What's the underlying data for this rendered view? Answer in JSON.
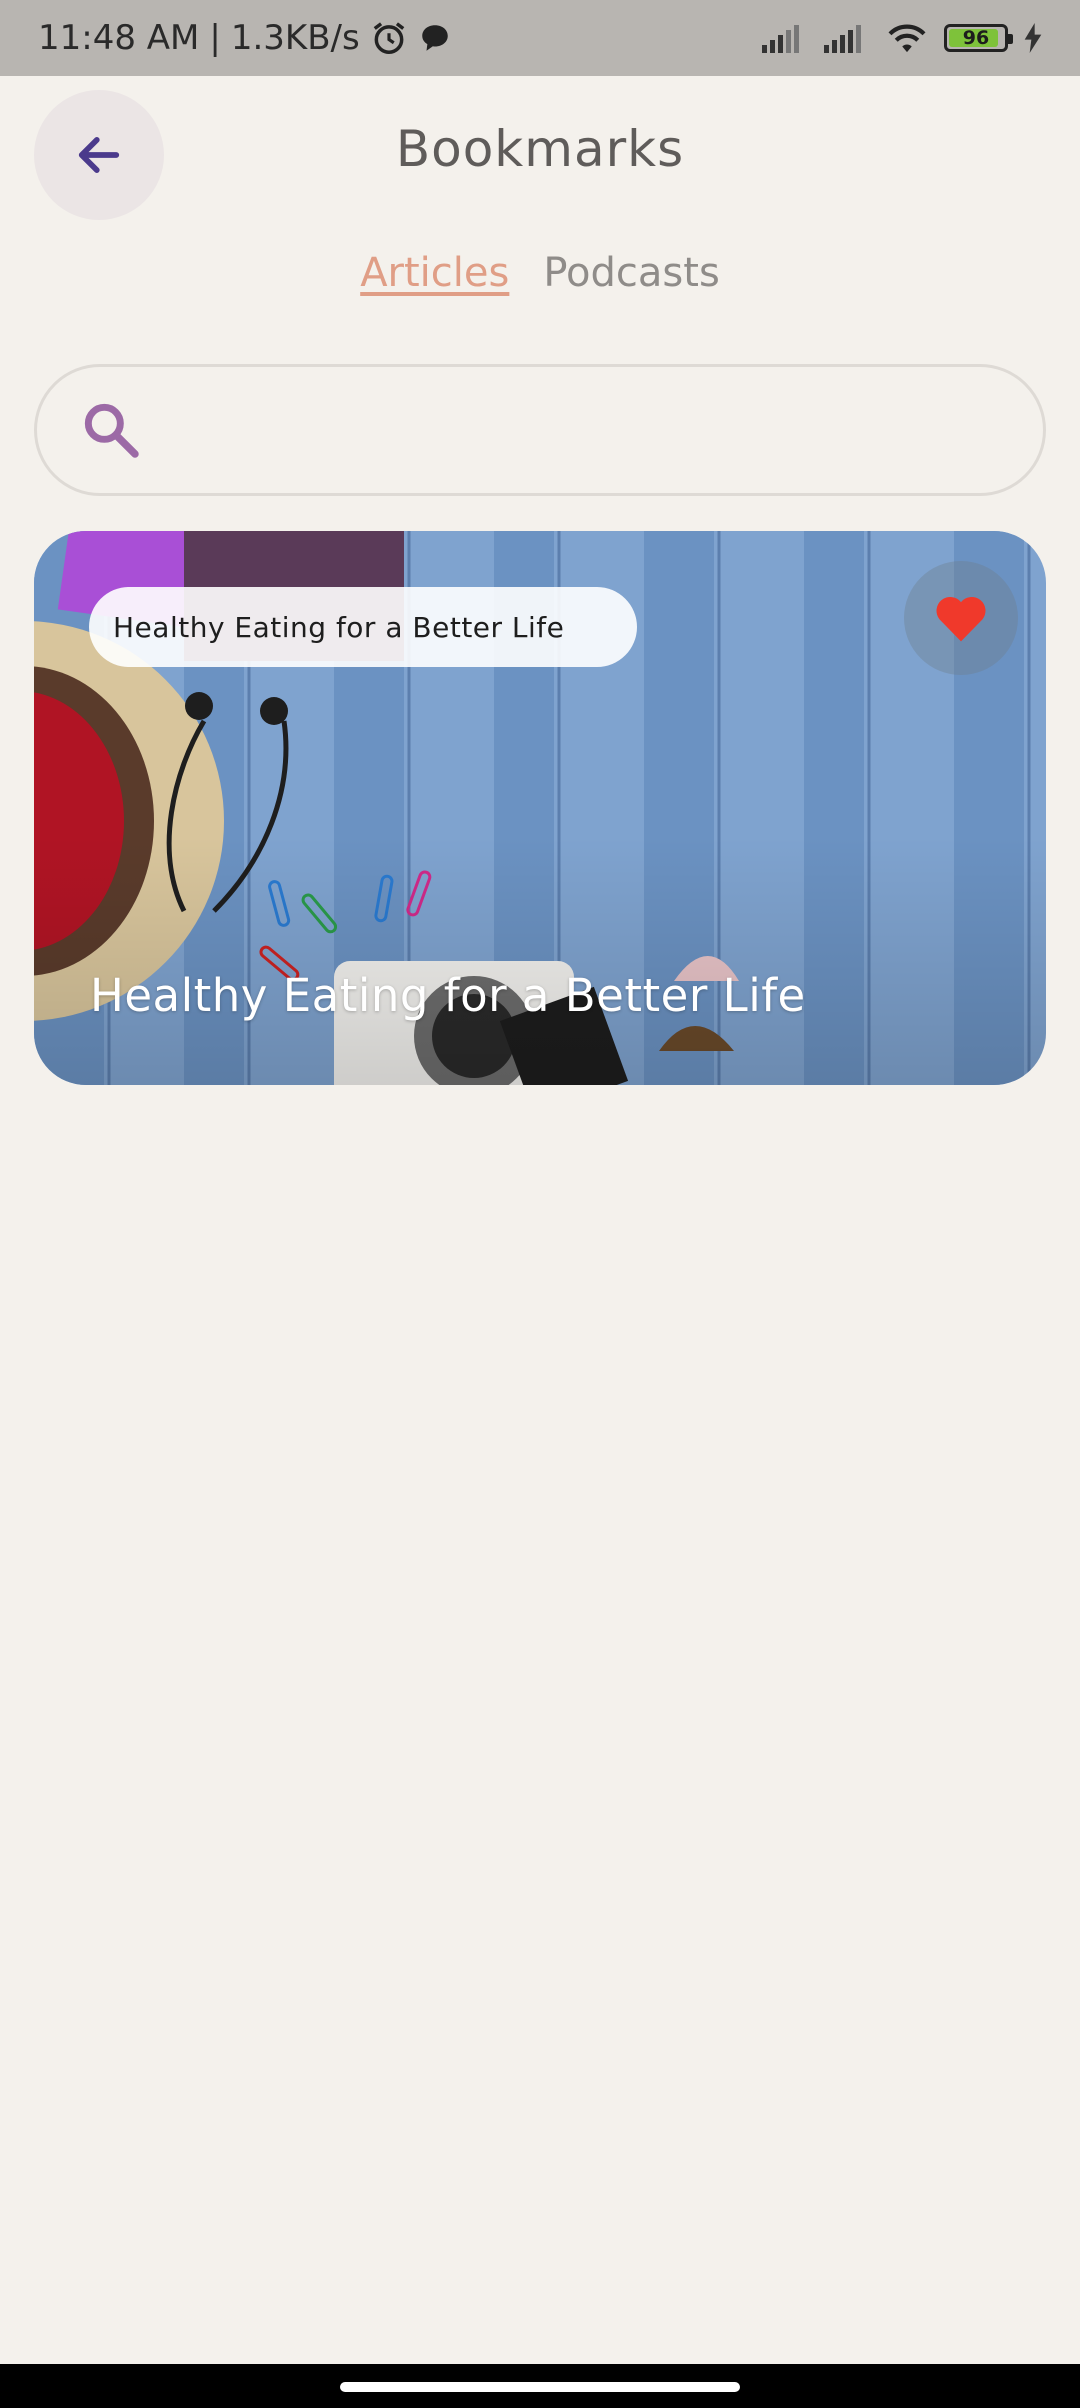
{
  "status_bar": {
    "time": "11:48 AM",
    "separator": "|",
    "speed": "1.3KB/s",
    "battery": "96",
    "icons": [
      "alarm-icon",
      "chat-icon",
      "signal-icon",
      "signal-icon",
      "wifi-icon",
      "battery-icon",
      "charging-icon"
    ]
  },
  "header": {
    "title": "Bookmarks",
    "back_icon": "arrow-left-icon"
  },
  "tabs": [
    {
      "label": "Articles",
      "active": true
    },
    {
      "label": "Podcasts",
      "active": false
    }
  ],
  "search": {
    "placeholder": "",
    "value": "",
    "icon": "search-icon"
  },
  "cards": [
    {
      "chip_label": "Healthy Eating for a Better Life",
      "title": "Healthy Eating for a Better Life",
      "favorited": true
    }
  ],
  "colors": {
    "background": "#f4f1ec",
    "accent_tab": "#e09e86",
    "back_arrow": "#4b3a8c",
    "search_icon": "#9c6aa6",
    "heart": "#f0392b"
  }
}
